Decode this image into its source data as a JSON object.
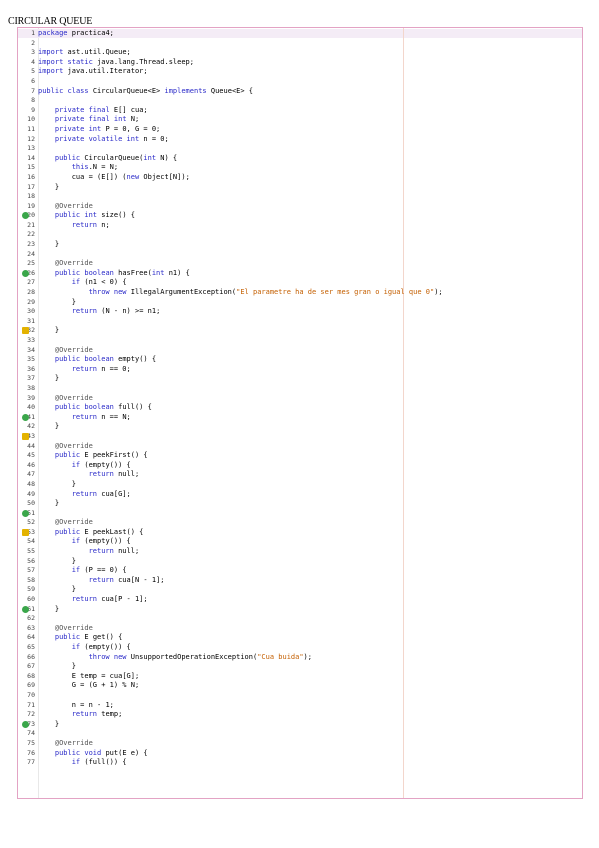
{
  "page": {
    "title": "CIRCULAR QUEUE"
  },
  "code_lines": [
    {
      "n": "1",
      "code": "package practica4;"
    },
    {
      "n": "2",
      "code": ""
    },
    {
      "n": "3",
      "code": "import ast.util.Queue;"
    },
    {
      "n": "4",
      "code": "import static java.lang.Thread.sleep;"
    },
    {
      "n": "5",
      "code": "import java.util.Iterator;"
    },
    {
      "n": "6",
      "code": ""
    },
    {
      "n": "7",
      "code": "public class CircularQueue<E> implements Queue<E> {"
    },
    {
      "n": "8",
      "code": ""
    },
    {
      "n": "9",
      "code": "    private final E[] cua;"
    },
    {
      "n": "10",
      "code": "    private final int N;"
    },
    {
      "n": "11",
      "code": "    private int P = 0, G = 0;"
    },
    {
      "n": "12",
      "code": "    private volatile int n = 0;"
    },
    {
      "n": "13",
      "code": ""
    },
    {
      "n": "14",
      "code": "    public CircularQueue(int N) {"
    },
    {
      "n": "15",
      "code": "        this.N = N;"
    },
    {
      "n": "16",
      "code": "        cua = (E[]) (new Object[N]);"
    },
    {
      "n": "17",
      "code": "    }"
    },
    {
      "n": "18",
      "code": ""
    },
    {
      "n": "19",
      "code": "    @Override"
    },
    {
      "n": "20",
      "code": "    public int size() {"
    },
    {
      "n": "21",
      "code": "        return n;"
    },
    {
      "n": "22",
      "code": ""
    },
    {
      "n": "23",
      "code": "    }"
    },
    {
      "n": "24",
      "code": ""
    },
    {
      "n": "25",
      "code": "    @Override"
    },
    {
      "n": "26",
      "code": "    public boolean hasFree(int n1) {"
    },
    {
      "n": "27",
      "code": "        if (n1 < 0) {"
    },
    {
      "n": "28",
      "code": "            throw new IllegalArgumentException(\"El parametre ha de ser mes gran o igual que 0\");"
    },
    {
      "n": "29",
      "code": "        }"
    },
    {
      "n": "30",
      "code": "        return (N - n) >= n1;"
    },
    {
      "n": "31",
      "code": ""
    },
    {
      "n": "32",
      "code": "    }"
    },
    {
      "n": "33",
      "code": ""
    },
    {
      "n": "34",
      "code": "    @Override"
    },
    {
      "n": "35",
      "code": "    public boolean empty() {"
    },
    {
      "n": "36",
      "code": "        return n == 0;"
    },
    {
      "n": "37",
      "code": "    }"
    },
    {
      "n": "38",
      "code": ""
    },
    {
      "n": "39",
      "code": "    @Override"
    },
    {
      "n": "40",
      "code": "    public boolean full() {"
    },
    {
      "n": "41",
      "code": "        return n == N;"
    },
    {
      "n": "42",
      "code": "    }"
    },
    {
      "n": "43",
      "code": ""
    },
    {
      "n": "44",
      "code": "    @Override"
    },
    {
      "n": "45",
      "code": "    public E peekFirst() {"
    },
    {
      "n": "46",
      "code": "        if (empty()) {"
    },
    {
      "n": "47",
      "code": "            return null;"
    },
    {
      "n": "48",
      "code": "        }"
    },
    {
      "n": "49",
      "code": "        return cua[G];"
    },
    {
      "n": "50",
      "code": "    }"
    },
    {
      "n": "51",
      "code": ""
    },
    {
      "n": "52",
      "code": "    @Override"
    },
    {
      "n": "53",
      "code": "    public E peekLast() {"
    },
    {
      "n": "54",
      "code": "        if (empty()) {"
    },
    {
      "n": "55",
      "code": "            return null;"
    },
    {
      "n": "56",
      "code": "        }"
    },
    {
      "n": "57",
      "code": "        if (P == 0) {"
    },
    {
      "n": "58",
      "code": "            return cua[N - 1];"
    },
    {
      "n": "59",
      "code": "        }"
    },
    {
      "n": "60",
      "code": "        return cua[P - 1];"
    },
    {
      "n": "61",
      "code": "    }"
    },
    {
      "n": "62",
      "code": ""
    },
    {
      "n": "63",
      "code": "    @Override"
    },
    {
      "n": "64",
      "code": "    public E get() {"
    },
    {
      "n": "65",
      "code": "        if (empty()) {"
    },
    {
      "n": "66",
      "code": "            throw new UnsupportedOperationException(\"Cua buida\");"
    },
    {
      "n": "67",
      "code": "        }"
    },
    {
      "n": "68",
      "code": "        E temp = cua[G];"
    },
    {
      "n": "69",
      "code": "        G = (G + 1) % N;"
    },
    {
      "n": "70",
      "code": ""
    },
    {
      "n": "71",
      "code": "        n = n - 1;"
    },
    {
      "n": "72",
      "code": "        return temp;"
    },
    {
      "n": "73",
      "code": "    }"
    },
    {
      "n": "74",
      "code": ""
    },
    {
      "n": "75",
      "code": "    @Override"
    },
    {
      "n": "76",
      "code": "    public void put(E e) {"
    },
    {
      "n": "77",
      "code": "        if (full()) {"
    }
  ],
  "gutter_icons": [
    {
      "line": "20",
      "kind": "override-marker-icon",
      "color": "#3aa64a"
    },
    {
      "line": "26",
      "kind": "override-marker-icon",
      "color": "#3aa64a"
    },
    {
      "line": "32",
      "kind": "hint-bulb-icon",
      "color": "#e3b200"
    },
    {
      "line": "41",
      "kind": "override-marker-icon",
      "color": "#3aa64a"
    },
    {
      "line": "43",
      "kind": "hint-bulb-icon",
      "color": "#e3b200"
    },
    {
      "line": "51",
      "kind": "override-marker-icon",
      "color": "#3aa64a"
    },
    {
      "line": "53",
      "kind": "hint-bulb-icon",
      "color": "#e3b200"
    },
    {
      "line": "61",
      "kind": "override-marker-icon",
      "color": "#3aa64a"
    },
    {
      "line": "73",
      "kind": "override-marker-icon",
      "color": "#3aa64a"
    }
  ],
  "colors": {
    "keyword": "#2a2ac8",
    "string": "#c45f00",
    "annotation": "#555555",
    "border": "#e3a3c4"
  }
}
